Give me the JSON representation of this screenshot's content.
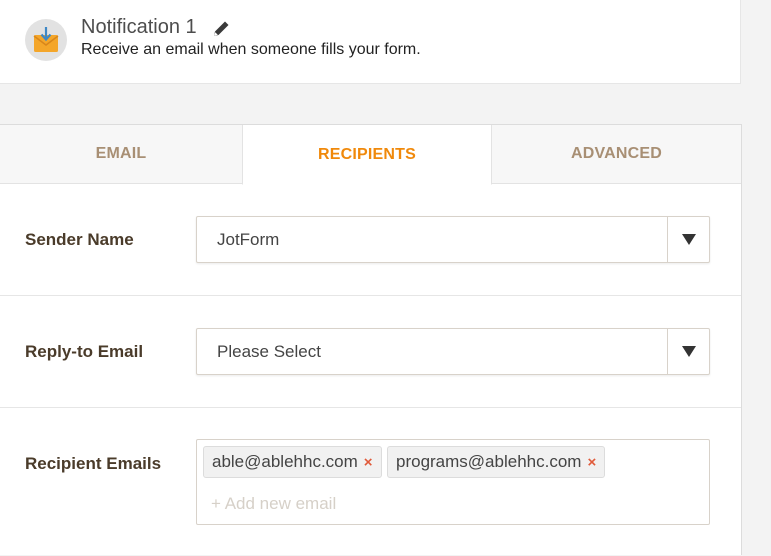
{
  "notification": {
    "title": "Notification 1",
    "description": "Receive an email when someone fills your form.",
    "icon": "envelope-download-icon",
    "edit_icon": "pencil-icon"
  },
  "tabs": [
    {
      "label": "EMAIL",
      "active": false
    },
    {
      "label": "RECIPIENTS",
      "active": true
    },
    {
      "label": "ADVANCED",
      "active": false
    }
  ],
  "sender_name": {
    "label": "Sender Name",
    "value": "JotForm"
  },
  "reply_to": {
    "label": "Reply-to Email",
    "value": "Please Select"
  },
  "recipients": {
    "label": "Recipient Emails",
    "emails": [
      "able@ablehhc.com",
      "programs@ablehhc.com"
    ],
    "remove_glyph": "×",
    "add_placeholder": "+ Add new email"
  },
  "colors": {
    "accent": "#f0890b",
    "inactive_tab": "#a88f74",
    "remove": "#e05a3a"
  }
}
